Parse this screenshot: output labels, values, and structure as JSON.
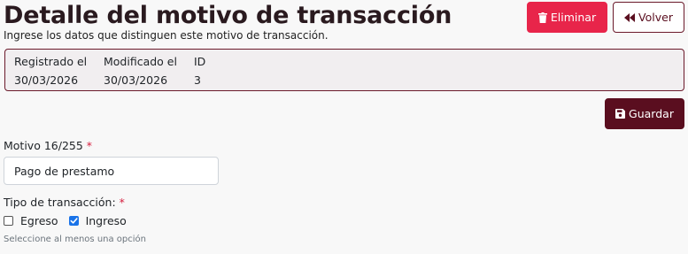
{
  "header": {
    "title": "Detalle del motivo de transacción",
    "subtitle": "Ingrese los datos que distinguen este motivo de transacción."
  },
  "actions": {
    "delete_label": "Eliminar",
    "delete_icon": "trash-icon",
    "back_label": "Volver",
    "back_icon": "double-chevron-left-icon",
    "save_label": "Guardar",
    "save_icon": "floppy-disk-icon"
  },
  "info": {
    "registered_label": "Registrado el",
    "registered_value": "30/03/2026",
    "modified_label": "Modificado el",
    "modified_value": "30/03/2026",
    "id_label": "ID",
    "id_value": "3"
  },
  "form": {
    "motivo": {
      "label": "Motivo 16/255",
      "required_mark": "*",
      "value": "Pago de prestamo"
    },
    "tipo": {
      "label": "Tipo de transacción:",
      "required_mark": "*",
      "options": [
        {
          "label": "Egreso",
          "checked": false
        },
        {
          "label": "Ingreso",
          "checked": true
        }
      ],
      "hint": "Seleccione al menos una opción"
    }
  },
  "colors": {
    "accent": "#5a0e1f",
    "danger": "#e8254a",
    "checkbox": "#1a73e8"
  }
}
